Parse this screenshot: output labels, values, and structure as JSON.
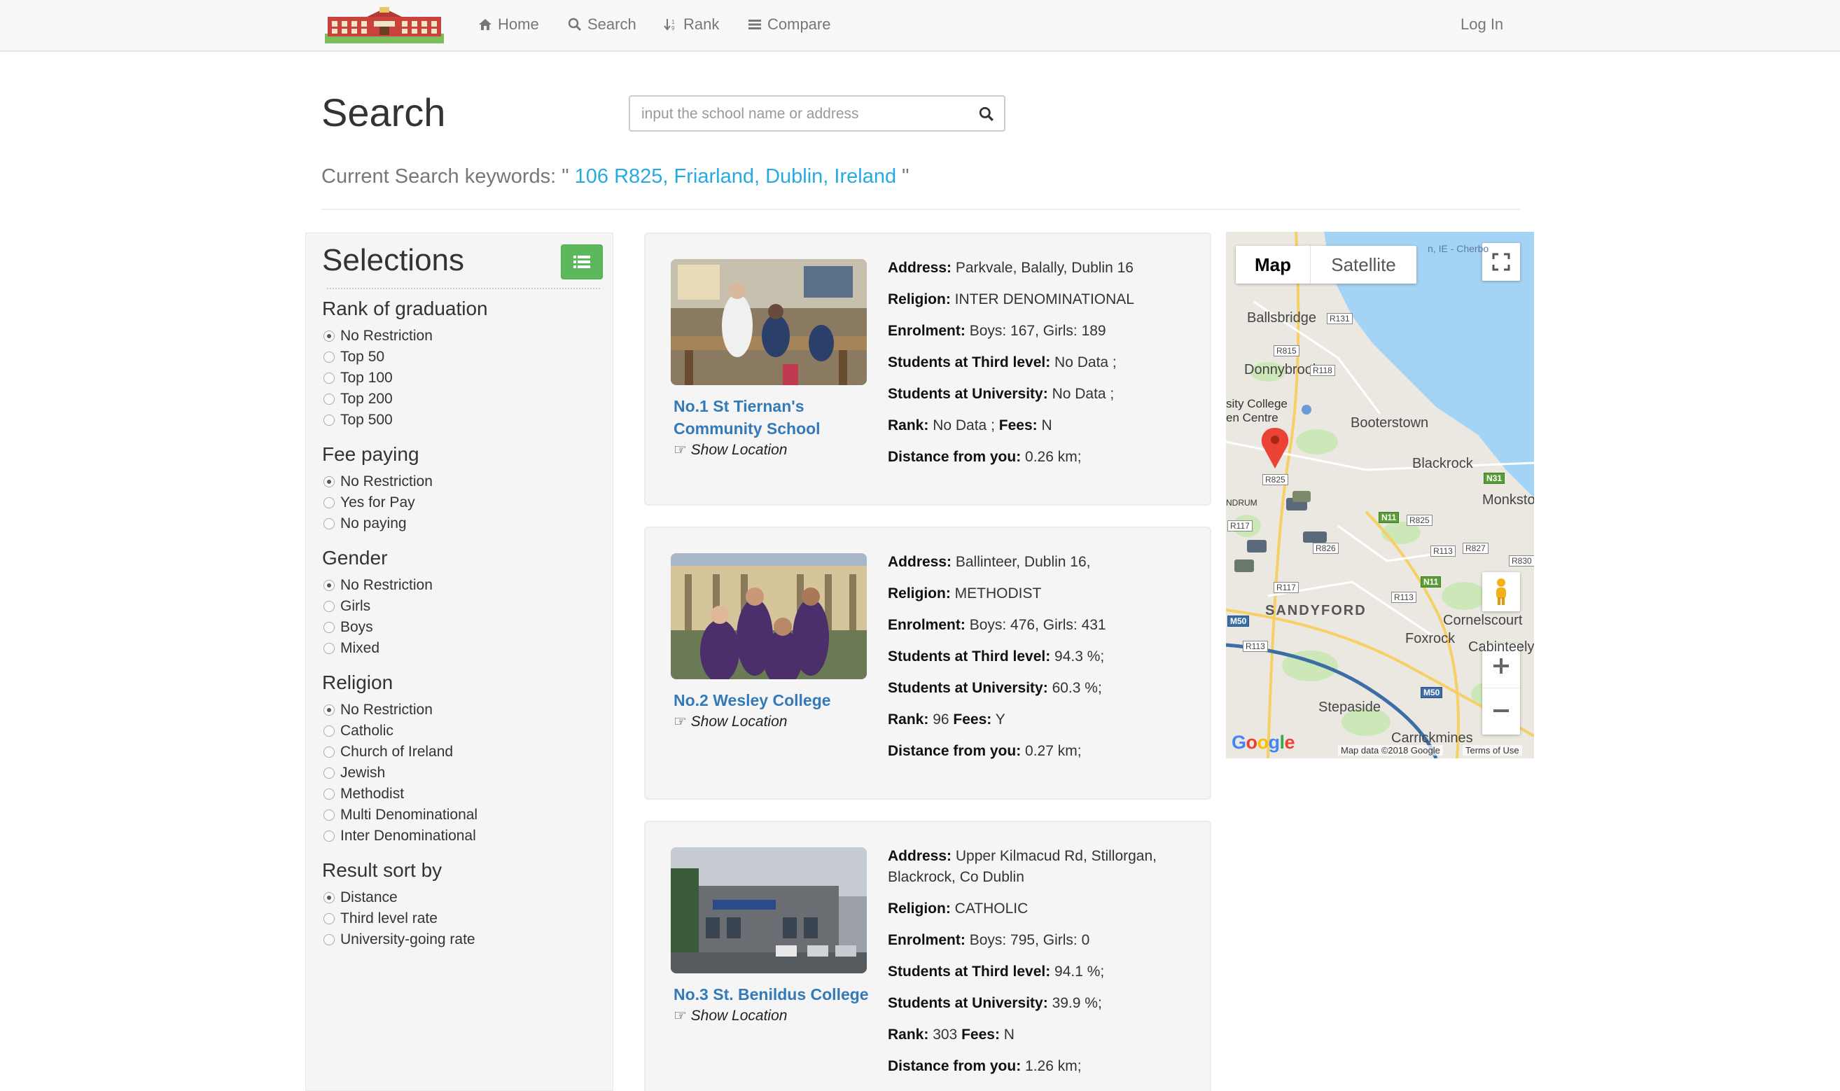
{
  "nav": {
    "home": "Home",
    "search": "Search",
    "rank": "Rank",
    "compare": "Compare",
    "login": "Log In"
  },
  "header": {
    "title": "Search",
    "search_placeholder": "input the school name or address",
    "keywords_prefix": "Current Search keywords: \"",
    "keywords_value": "106 R825, Friarland, Dublin, Ireland",
    "keywords_suffix": "\""
  },
  "sidebar": {
    "title": "Selections",
    "groups": [
      {
        "title": "Rank of graduation",
        "options": [
          "No Restriction",
          "Top 50",
          "Top 100",
          "Top 200",
          "Top 500"
        ],
        "selected": 0
      },
      {
        "title": "Fee paying",
        "options": [
          "No Restriction",
          "Yes for Pay",
          "No paying"
        ],
        "selected": 0
      },
      {
        "title": "Gender",
        "options": [
          "No Restriction",
          "Girls",
          "Boys",
          "Mixed"
        ],
        "selected": 0
      },
      {
        "title": "Religion",
        "options": [
          "No Restriction",
          "Catholic",
          "Church of Ireland",
          "Jewish",
          "Methodist",
          "Multi Denominational",
          "Inter Denominational"
        ],
        "selected": 0
      },
      {
        "title": "Result sort by",
        "options": [
          "Distance",
          "Third level rate",
          "University-going rate"
        ],
        "selected": 0
      }
    ]
  },
  "labels": {
    "address": "Address:",
    "religion": "Religion:",
    "enrolment": "Enrolment:",
    "third_level": "Students at Third level:",
    "university": "Students at University:",
    "rank": "Rank:",
    "fees": "Fees:",
    "distance": "Distance from you:",
    "show_location": "☞ Show Location"
  },
  "schools": [
    {
      "name": "No.1 St Tiernan's Community School",
      "address": "Parkvale, Balally, Dublin 16",
      "religion": "INTER DENOMINATIONAL",
      "enrolment": "Boys: 167, Girls: 189",
      "third_level": "No Data ;",
      "university": "No Data ;",
      "rank": "No Data ;",
      "fees": "N",
      "distance": "0.26 km;"
    },
    {
      "name": "No.2 Wesley College",
      "address": "Ballinteer, Dublin 16,",
      "religion": "METHODIST",
      "enrolment": "Boys: 476, Girls: 431",
      "third_level": "94.3 %;",
      "university": "60.3 %;",
      "rank": "96",
      "fees": "Y",
      "distance": "0.27 km;"
    },
    {
      "name": "No.3 St. Benildus College",
      "address": "Upper Kilmacud Rd, Stillorgan, Blackrock, Co Dublin",
      "religion": "CATHOLIC",
      "enrolment": "Boys: 795, Girls: 0",
      "third_level": "94.1 %;",
      "university": "39.9 %;",
      "rank": "303",
      "fees": "N",
      "distance": "1.26 km;"
    }
  ],
  "map": {
    "tab_map": "Map",
    "tab_satellite": "Satellite",
    "places": [
      "Ballsbridge",
      "Donnybrook",
      "sity College",
      "en Centre",
      "Booterstown",
      "Blackrock",
      "Monkstown",
      "SANDYFORD",
      "Cornelscourt",
      "Foxrock",
      "Cabinteely",
      "Stepaside",
      "Carrickmines",
      "NDRUM"
    ],
    "roads": [
      "R131",
      "R815",
      "R118",
      "R825",
      "R117",
      "R826",
      "R825",
      "R113",
      "R827",
      "R830",
      "R113",
      "R113",
      "R117"
    ],
    "motorways": [
      "N31",
      "N11",
      "N11",
      "M50",
      "M50"
    ],
    "google": "Google",
    "attribution": "Map data ©2018 Google",
    "terms": "Terms of Use",
    "corner_text": "n, IE - Cherbo"
  }
}
